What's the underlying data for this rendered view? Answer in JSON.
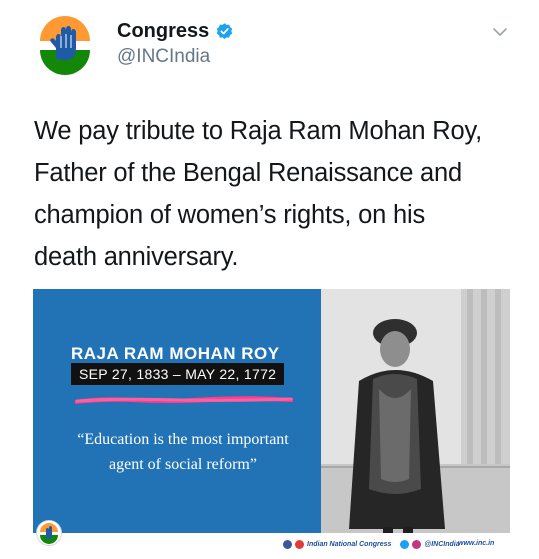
{
  "tweet": {
    "display_name": "Congress",
    "handle": "@INCIndia",
    "text_lines": [
      "We pay tribute to Raja Ram Mohan Roy,",
      "Father of the Bengal Renaissance and",
      "champion of women’s rights, on his",
      "death anniversary."
    ],
    "icons": {
      "avatar": "congress-hand-logo",
      "verified": "verified-badge-icon",
      "menu": "chevron-down-icon"
    }
  },
  "media": {
    "person_name": "RAJA RAM MOHAN ROY",
    "dates": "SEP 27, 1833 – MAY 22, 1772",
    "quote_line1": "“Education is the most important",
    "quote_line2": "agent of social reform”",
    "footer_org": "Indian National Congress",
    "footer_handle": "@INCIndia",
    "footer_site": "www.inc.in"
  },
  "colors": {
    "media_blue": "#2273b5",
    "highlight_pink": "#ff3d8b",
    "verified_blue": "#1da1f2",
    "saffron": "#ff9933",
    "green": "#138808"
  }
}
